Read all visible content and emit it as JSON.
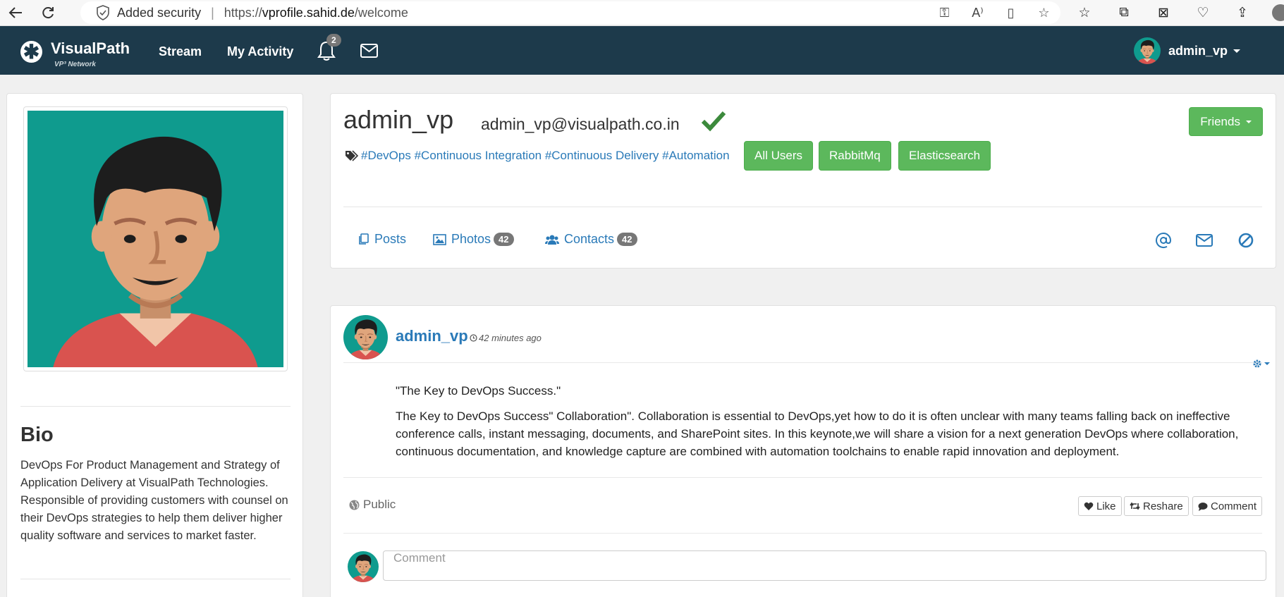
{
  "browser": {
    "security_label": "Added security",
    "url_prefix": "https://",
    "url_host": "vprofile.sahid.de",
    "url_path": "/welcome",
    "icons": [
      "back-icon",
      "refresh-icon",
      "shield-icon",
      "key-icon",
      "read-aloud-icon",
      "immersive-reader-icon",
      "add-favorite-icon",
      "favorites-icon",
      "collections-icon",
      "math-solver-icon",
      "browser-essentials-icon",
      "share-icon",
      "profile-icon"
    ]
  },
  "navbar": {
    "brand_name": "VisualPath",
    "brand_sub": "VP³ Network",
    "links": [
      "Stream",
      "My Activity"
    ],
    "notification_count": "2",
    "username": "admin_vp",
    "bg_color": "#1d3a4b"
  },
  "profile": {
    "username": "admin_vp",
    "email": "admin_vp@visualpath.co.in",
    "tags": "#DevOps #Continuous Integration #Continuous Delivery #Automation",
    "tag_buttons": [
      "All Users",
      "RabbitMq",
      "Elasticsearch"
    ],
    "friends_label": "Friends",
    "tabs": {
      "posts": "Posts",
      "photos": "Photos",
      "photos_count": "42",
      "contacts": "Contacts",
      "contacts_count": "42"
    },
    "action_icons": [
      "at-icon",
      "envelope-icon",
      "block-icon"
    ]
  },
  "bio": {
    "title": "Bio",
    "text": "DevOps For Product Management and Strategy of Application Delivery at VisualPath Technologies. Responsible of providing customers with counsel on their DevOps strategies to help them deliver higher quality software and services to market faster."
  },
  "post": {
    "author": "admin_vp",
    "time": "42 minutes ago",
    "title": "\"The Key to DevOps Success.\"",
    "body": "The Key to DevOps Success\" Collaboration\". Collaboration is essential to DevOps,yet how to do it is often unclear with many teams falling back on ineffective conference calls, instant messaging, documents, and SharePoint sites. In this keynote,we will share a vision for a next generation DevOps where collaboration, continuous documentation, and knowledge capture are combined with automation toolchains to enable rapid innovation and deployment.",
    "visibility": "Public",
    "like": "Like",
    "reshare": "Reshare",
    "comment": "Comment",
    "comment_placeholder": "Comment"
  },
  "colors": {
    "accent_green": "#5cb85c",
    "link_blue": "#2a7ab8",
    "avatar_teal": "#0f9b8e"
  }
}
